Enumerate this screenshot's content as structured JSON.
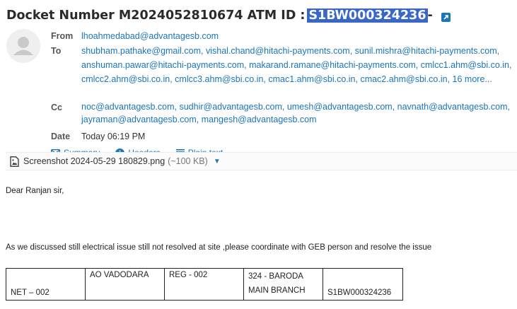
{
  "subject": {
    "prefix": "Docket Number M2024052810674 ATM ID :",
    "highlight": "S1BW000324236",
    "suffix": "-"
  },
  "headers": {
    "from_label": "From",
    "from": "lhoahmedabad@advantagesb.com",
    "to_label": "To",
    "to_line1": "shubham.pathake@gmail.com, vishal.chand@hitachi-payments.com, sunil.mishra@hitachi-payments.com,",
    "to_line2": "anshuman.pawar@hitachi-payments.com, makarand.ramane@hitachi-payments.com, cmlcc1.ahm@sbi.co.in,",
    "to_line3": "cmlcc2.ahm@sbi.co.in, cmlcc3.ahm@sbi.co.in, cmac1.ahm@sbi.co.in, cmac2.ahm@sbi.co.in, 16 more...",
    "cc_label": "Cc",
    "cc_line1": "noc@advantagesb.com, sudhir@advantagesb.com, umesh@advantagesb.com, navnath@advantagesb.com,",
    "cc_line2": "jayraman@advantagesb.com, mangesh@advantagesb.com",
    "date_label": "Date",
    "date": "Today 06:19 PM"
  },
  "views": {
    "summary": "Summary",
    "headers": "Headers",
    "plain_text": "Plain text"
  },
  "attachment": {
    "name": "Screenshot 2024-05-29 180829.png",
    "size": "(~100 KB)"
  },
  "body": {
    "greeting": "Dear Ranjan sir,",
    "message": "As we discussed still electrical issue still  not resolved at site ,please coordinate with GEB person and resolve the issue"
  },
  "table": {
    "c1": "NET – 002",
    "c2": "AO VADODARA",
    "c3": "REG - 002",
    "c4_line1": "324 - BARODA",
    "c4_line2": "MAIN BRANCH",
    "c5": "S1BW000324236"
  },
  "colors": {
    "link": "#1b75bb",
    "highlight": "#3967c8"
  }
}
